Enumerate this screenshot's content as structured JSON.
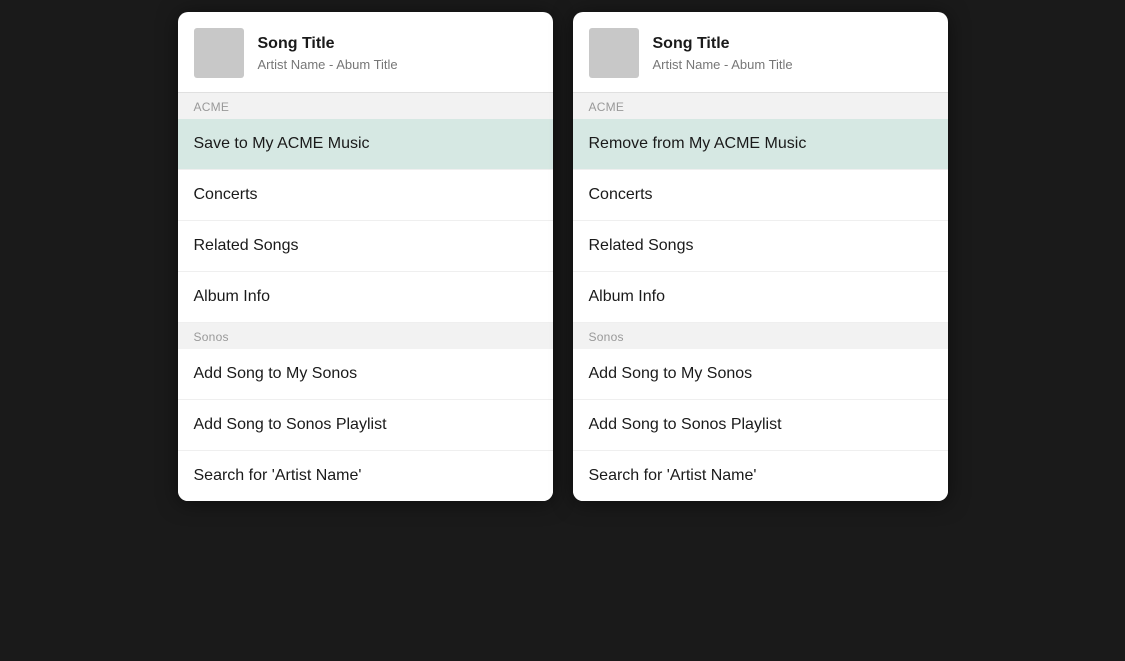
{
  "panel1": {
    "song": {
      "title": "Song Title",
      "subtitle": "Artist Name - Abum Title"
    },
    "sections": [
      {
        "header": "ACME",
        "items": [
          {
            "label": "Save to My ACME Music",
            "highlighted": true
          }
        ]
      },
      {
        "header": null,
        "items": [
          {
            "label": "Concerts",
            "highlighted": false
          },
          {
            "label": "Related Songs",
            "highlighted": false
          },
          {
            "label": "Album Info",
            "highlighted": false
          }
        ]
      },
      {
        "header": "Sonos",
        "items": [
          {
            "label": "Add Song to My Sonos",
            "highlighted": false
          },
          {
            "label": "Add Song to Sonos Playlist",
            "highlighted": false
          },
          {
            "label": "Search for 'Artist Name'",
            "highlighted": false
          }
        ]
      }
    ]
  },
  "panel2": {
    "song": {
      "title": "Song Title",
      "subtitle": "Artist Name - Abum Title"
    },
    "sections": [
      {
        "header": "ACME",
        "items": [
          {
            "label": "Remove from My ACME Music",
            "highlighted": true
          }
        ]
      },
      {
        "header": null,
        "items": [
          {
            "label": "Concerts",
            "highlighted": false
          },
          {
            "label": "Related Songs",
            "highlighted": false
          },
          {
            "label": "Album Info",
            "highlighted": false
          }
        ]
      },
      {
        "header": "Sonos",
        "items": [
          {
            "label": "Add Song to My Sonos",
            "highlighted": false
          },
          {
            "label": "Add Song to Sonos Playlist",
            "highlighted": false
          },
          {
            "label": "Search for 'Artist Name'",
            "highlighted": false
          }
        ]
      }
    ]
  }
}
